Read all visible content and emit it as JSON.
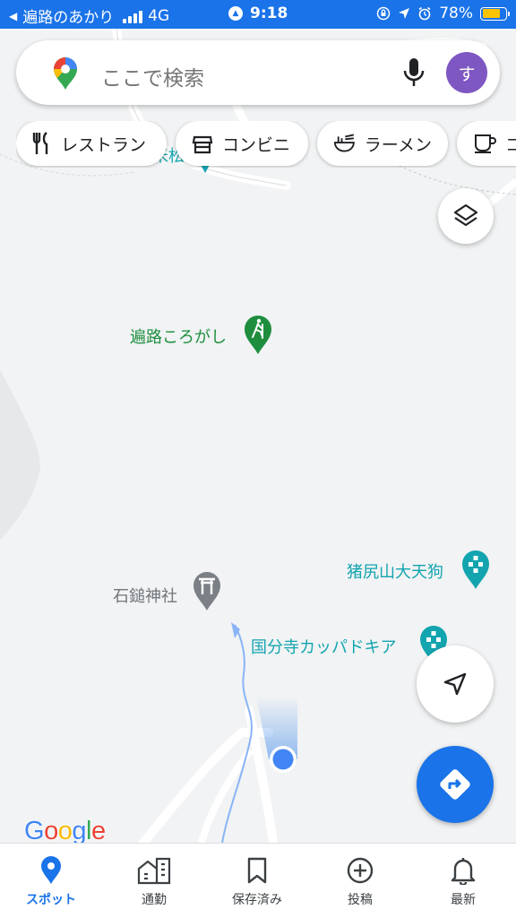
{
  "status_bar": {
    "back_app": "遍路のあかり",
    "network": "4G",
    "time": "9:18",
    "battery": "78%",
    "battery_level": 0.78
  },
  "search": {
    "placeholder": "ここで検索",
    "avatar_letter": "す"
  },
  "chips": [
    {
      "label": "レストラン",
      "icon": "fork-knife-icon"
    },
    {
      "label": "コンビニ",
      "icon": "store-icon"
    },
    {
      "label": "ラーメン",
      "icon": "ramen-bowl-icon"
    },
    {
      "label": "コ",
      "icon": "coffee-cup-icon"
    }
  ],
  "places": {
    "top_partial": "米松",
    "henro": "遍路ころがし",
    "tengu": "猪尻山大天狗",
    "shrine": "石鎚神社",
    "kappa": "国分寺カッパドキア"
  },
  "brand": {
    "logo_letters": [
      "G",
      "o",
      "o",
      "g",
      "l",
      "e"
    ],
    "logo_colors": [
      "#4285f4",
      "#ea4335",
      "#fbbc05",
      "#4285f4",
      "#34a853",
      "#ea4335"
    ]
  },
  "bottom_nav": [
    {
      "label": "スポット",
      "icon": "location-pin-icon",
      "active": true
    },
    {
      "label": "通勤",
      "icon": "commute-buildings-icon",
      "active": false
    },
    {
      "label": "保存済み",
      "icon": "bookmark-icon",
      "active": false
    },
    {
      "label": "投稿",
      "icon": "add-circle-icon",
      "active": false
    },
    {
      "label": "最新",
      "icon": "bell-icon",
      "active": false
    }
  ],
  "colors": {
    "accent": "#1a73e8",
    "poi_green": "#1e8e3e",
    "poi_teal": "#12a4af",
    "avatar": "#7e57c2"
  }
}
